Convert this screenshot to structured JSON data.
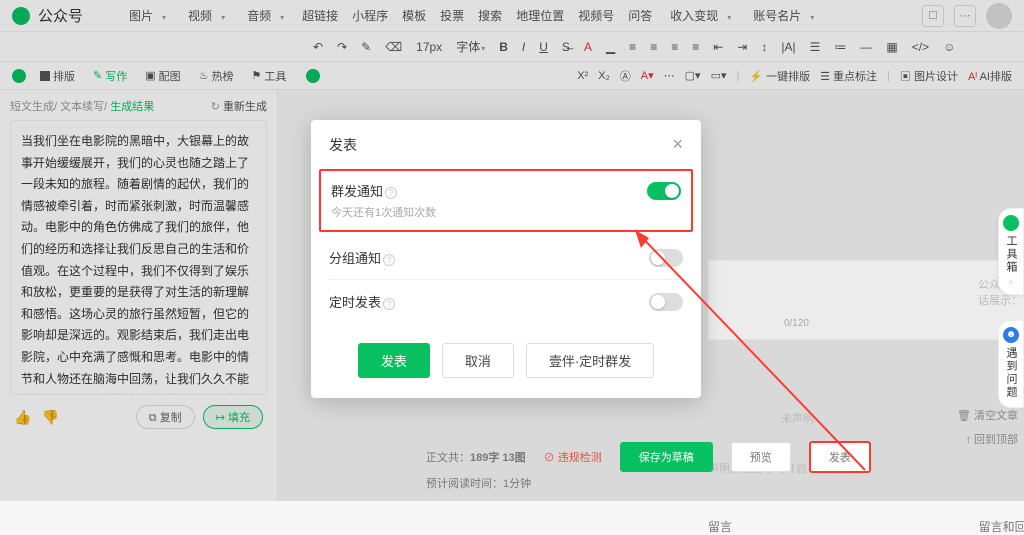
{
  "header": {
    "brand": "公众号",
    "menu": [
      "图片",
      "视频",
      "音频",
      "超链接",
      "小程序",
      "模板",
      "投票",
      "搜索",
      "地理位置",
      "视频号",
      "问答",
      "收入变现",
      "账号名片"
    ]
  },
  "toolbar": {
    "font_size": "17px",
    "font_family": "字体",
    "items2": [
      "X²",
      "X₂",
      "—",
      "A",
      "一键排版",
      "重点标注",
      "图片设计",
      "AI排版"
    ]
  },
  "tabs": {
    "items": [
      {
        "icon": "layout",
        "label": "排版"
      },
      {
        "icon": "edit",
        "label": "写作",
        "active": true
      },
      {
        "icon": "image",
        "label": "配图"
      },
      {
        "icon": "fire",
        "label": "热榜"
      },
      {
        "icon": "tool",
        "label": "工具"
      }
    ]
  },
  "left": {
    "breadcrumb": {
      "a": "短文生成",
      "b": "文本续写",
      "c": "生成结果"
    },
    "regen": "重新生成",
    "body": "当我们坐在电影院的黑暗中，大银幕上的故事开始缓缓展开，我们的心灵也随之踏上了一段未知的旅程。随着剧情的起伏，我们的情感被牵引着，时而紧张刺激，时而温馨感动。电影中的角色仿佛成了我们的旅伴，他们的经历和选择让我们反思自己的生活和价值观。在这个过程中，我们不仅得到了娱乐和放松，更重要的是获得了对生活的新理解和感悟。这场心灵的旅行虽然短暂，但它的影响却是深远的。观影结束后，我们走出电影院，心中充满了感慨和思考。电影中的情节和人物还在脑海中回荡，让我们久久不能忘怀。这场心灵的旅行虽然结束了，但它带给我们的启示和感悟却会伴随我们继续前行，在现实生活中找到新的灵感和动力。这就是电影的魅力所在——它让我们在短短几个小时内体验了不同的人生，开阔了视野，丰富了内心世界。",
    "copy": "复制",
    "fill": "填充"
  },
  "modal": {
    "title": "发表",
    "row1": {
      "label": "群发通知",
      "sub": "今天还有1次通知次数"
    },
    "row2": {
      "label": "分组通知"
    },
    "row3": {
      "label": "定时发表"
    },
    "publish": "发表",
    "cancel": "取消",
    "companion": "壹伴·定时群发"
  },
  "under": {
    "msg_label": "留言",
    "msg_right": "留言和回复自动精选公开",
    "text_count_label": "正文共：",
    "text_count": "189字 13图",
    "read_time_label": "预计阅读时间：",
    "read_time": "1分钟",
    "violation": "违规检测",
    "save_draft": "保存为草稿",
    "preview": "预览",
    "publish": "发表",
    "clear": "清空文章",
    "back_top": "回到顶部"
  },
  "faint": {
    "hint": "公众号会话展示：",
    "count": "0/120",
    "declare": "未声明",
    "ai_hint": "声明原创后才可开启",
    "toolbox": "工具箱",
    "feedback": "遇到问题"
  }
}
